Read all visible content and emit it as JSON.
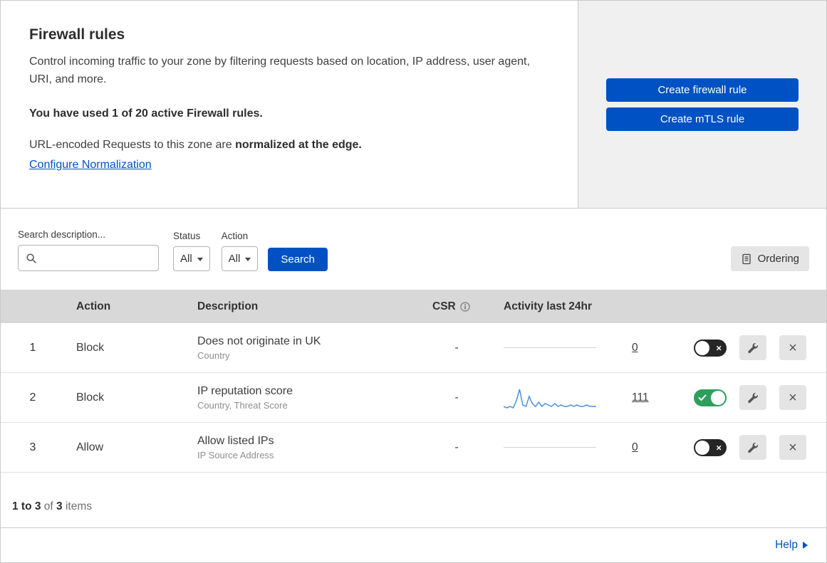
{
  "colors": {
    "accent": "#0051c3",
    "toggle_on": "#2e9e5c",
    "sparkline": "#4a90d9",
    "table_header_bg": "#d8d8d8"
  },
  "header": {
    "title": "Firewall rules",
    "description": "Control incoming traffic to your zone by filtering requests based on location, IP address, user agent, URI, and more.",
    "usage": "You have used 1 of 20 active Firewall rules.",
    "normalization": {
      "prefix": "URL-encoded Requests to this zone are ",
      "bold": "normalized at the edge."
    },
    "link": "Configure Normalization",
    "actions": {
      "create_firewall": "Create firewall rule",
      "create_mtls": "Create mTLS rule"
    }
  },
  "filters": {
    "search_label": "Search description...",
    "status_label": "Status",
    "status_value": "All",
    "action_label": "Action",
    "action_value": "All",
    "search_button": "Search",
    "ordering_button": "Ordering"
  },
  "table": {
    "headers": {
      "action": "Action",
      "description": "Description",
      "csr": "CSR",
      "activity": "Activity last 24hr"
    },
    "rows": [
      {
        "num": "1",
        "action": "Block",
        "title": "Does not originate in UK",
        "subtitle": "Country",
        "csr": "-",
        "activity": "0",
        "enabled": false
      },
      {
        "num": "2",
        "action": "Block",
        "title": "IP reputation score",
        "subtitle": "Country, Threat Score",
        "csr": "-",
        "activity": "111",
        "enabled": true
      },
      {
        "num": "3",
        "action": "Allow",
        "title": "Allow listed IPs",
        "subtitle": "IP Source Address",
        "csr": "-",
        "activity": "0",
        "enabled": false
      }
    ]
  },
  "sparkline": {
    "values": [
      2,
      1,
      2,
      1,
      6,
      14,
      3,
      2,
      9,
      4,
      2,
      5,
      2,
      4,
      3,
      2,
      4,
      2,
      3,
      2,
      2,
      3,
      2,
      3,
      2,
      2,
      3,
      2,
      2,
      2
    ],
    "color": "#4a90d9"
  },
  "footer": {
    "range": "1 to 3",
    "of": " of ",
    "total": "3",
    "items": " items"
  },
  "help": "Help"
}
